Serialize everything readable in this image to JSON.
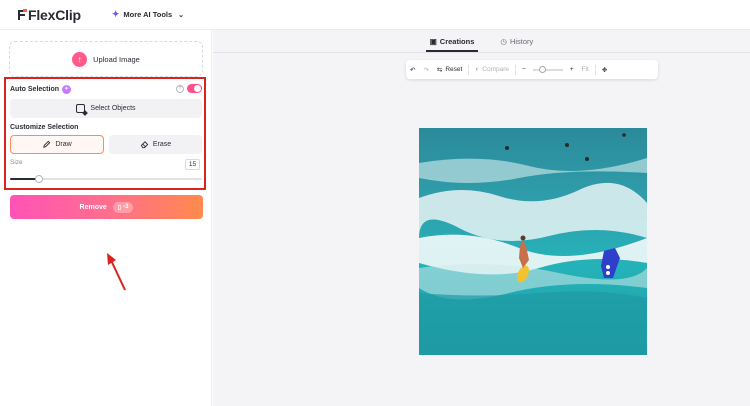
{
  "app": {
    "brand_part1": "Flex",
    "brand_part2": "Clip",
    "menu_label": "More AI Tools"
  },
  "left": {
    "upload_label": "Upload Image",
    "auto_selection_label": "Auto Selection",
    "auto_selection_on": true,
    "select_objects_label": "Select Objects",
    "customize_label": "Customize Selection",
    "draw_label": "Draw",
    "erase_label": "Erase",
    "size_label": "Size",
    "size_value": "15",
    "size_fraction": 0.15,
    "remove_label": "Remove",
    "remove_credit": "-3"
  },
  "right": {
    "tabs": [
      {
        "label": "Creations",
        "active": true
      },
      {
        "label": "History",
        "active": false
      }
    ],
    "toolbar": {
      "reset_label": "Reset",
      "compare_label": "Compare",
      "fit_label": "Fit",
      "zoom_fraction": 0.2
    }
  },
  "colors": {
    "accent_pink": "#ff4f8a",
    "highlight_red": "#d8231f",
    "draw_border": "#ff8a5c"
  },
  "icons": [
    "upload-icon",
    "sparkle-icon",
    "help-icon",
    "select-objects-icon",
    "pencil-icon",
    "eraser-icon",
    "undo-icon",
    "redo-icon",
    "reset-icon",
    "compare-icon",
    "zoom-out-icon",
    "zoom-in-icon",
    "move-icon",
    "creations-icon",
    "history-icon"
  ]
}
